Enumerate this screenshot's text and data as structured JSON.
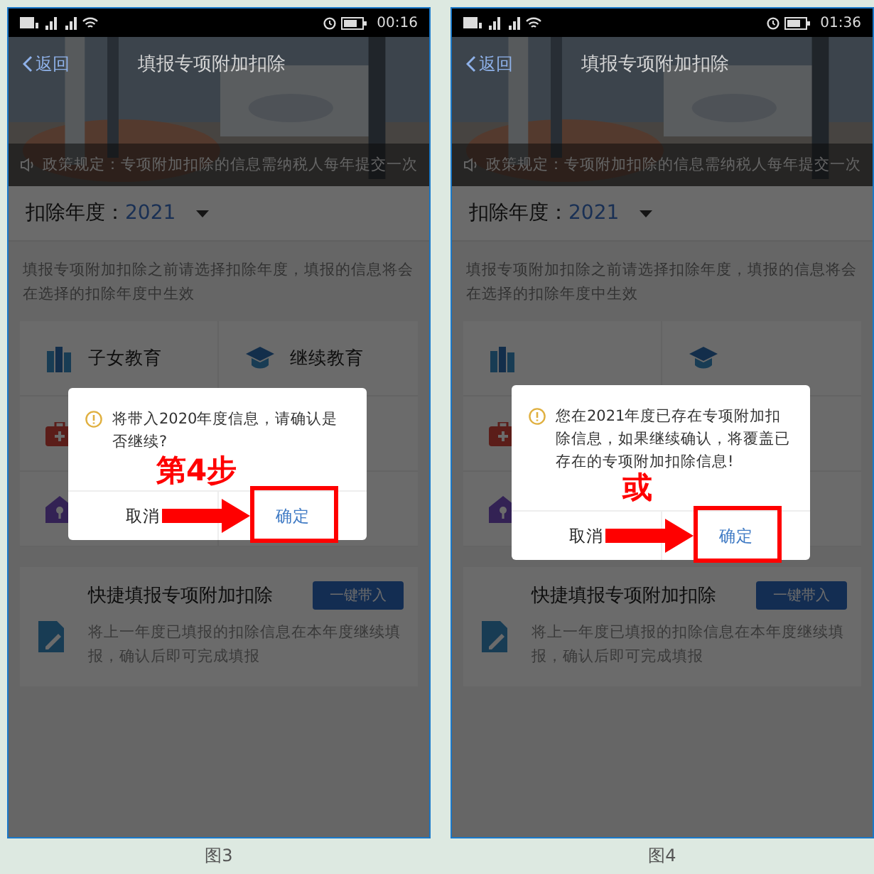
{
  "figures": [
    {
      "caption": "图3",
      "status_bar": {
        "time": "00:16"
      },
      "header": {
        "back": "返回",
        "title": "填报专项附加扣除"
      },
      "notice": "政策规定：专项附加扣除的信息需纳税人每年提交一次",
      "year": {
        "label": "扣除年度：",
        "value": "2021"
      },
      "hint": "填报专项附加扣除之前请选择扣除年度，填报的信息将会在选择的扣除年度中生效",
      "categories": [
        {
          "kind": "children",
          "label": "子女教育"
        },
        {
          "kind": "education",
          "label": "继续教育"
        },
        {
          "kind": "medical"
        },
        {
          "kind": "blank"
        },
        {
          "kind": "housing"
        },
        {
          "kind": "blank"
        }
      ],
      "quick": {
        "title": "快捷填报专项附加扣除",
        "button": "一键带入",
        "description": "将上一年度已填报的扣除信息在本年度继续填报，确认后即可完成填报"
      },
      "dialog": {
        "message": "将带入2020年度信息，请确认是否继续?",
        "cancel": "取消",
        "confirm": "确定"
      },
      "annotation": {
        "text": "第4步"
      }
    },
    {
      "caption": "图4",
      "status_bar": {
        "time": "01:36"
      },
      "header": {
        "back": "返回",
        "title": "填报专项附加扣除"
      },
      "notice": "政策规定：专项附加扣除的信息需纳税人每年提交一次",
      "year": {
        "label": "扣除年度：",
        "value": "2021"
      },
      "hint": "填报专项附加扣除之前请选择扣除年度，填报的信息将会在选择的扣除年度中生效",
      "categories": [
        {
          "kind": "children"
        },
        {
          "kind": "education"
        },
        {
          "kind": "medical"
        },
        {
          "kind": "blank"
        },
        {
          "kind": "housing"
        },
        {
          "kind": "blank"
        }
      ],
      "quick": {
        "title": "快捷填报专项附加扣除",
        "button": "一键带入",
        "description": "将上一年度已填报的扣除信息在本年度继续填报，确认后即可完成填报"
      },
      "dialog": {
        "message": "您在2021年度已存在专项附加扣除信息，如果继续确认，将覆盖已存在的专项附加扣除信息!",
        "cancel": "取消",
        "confirm": "确定"
      },
      "annotation": {
        "text": "或"
      }
    }
  ]
}
